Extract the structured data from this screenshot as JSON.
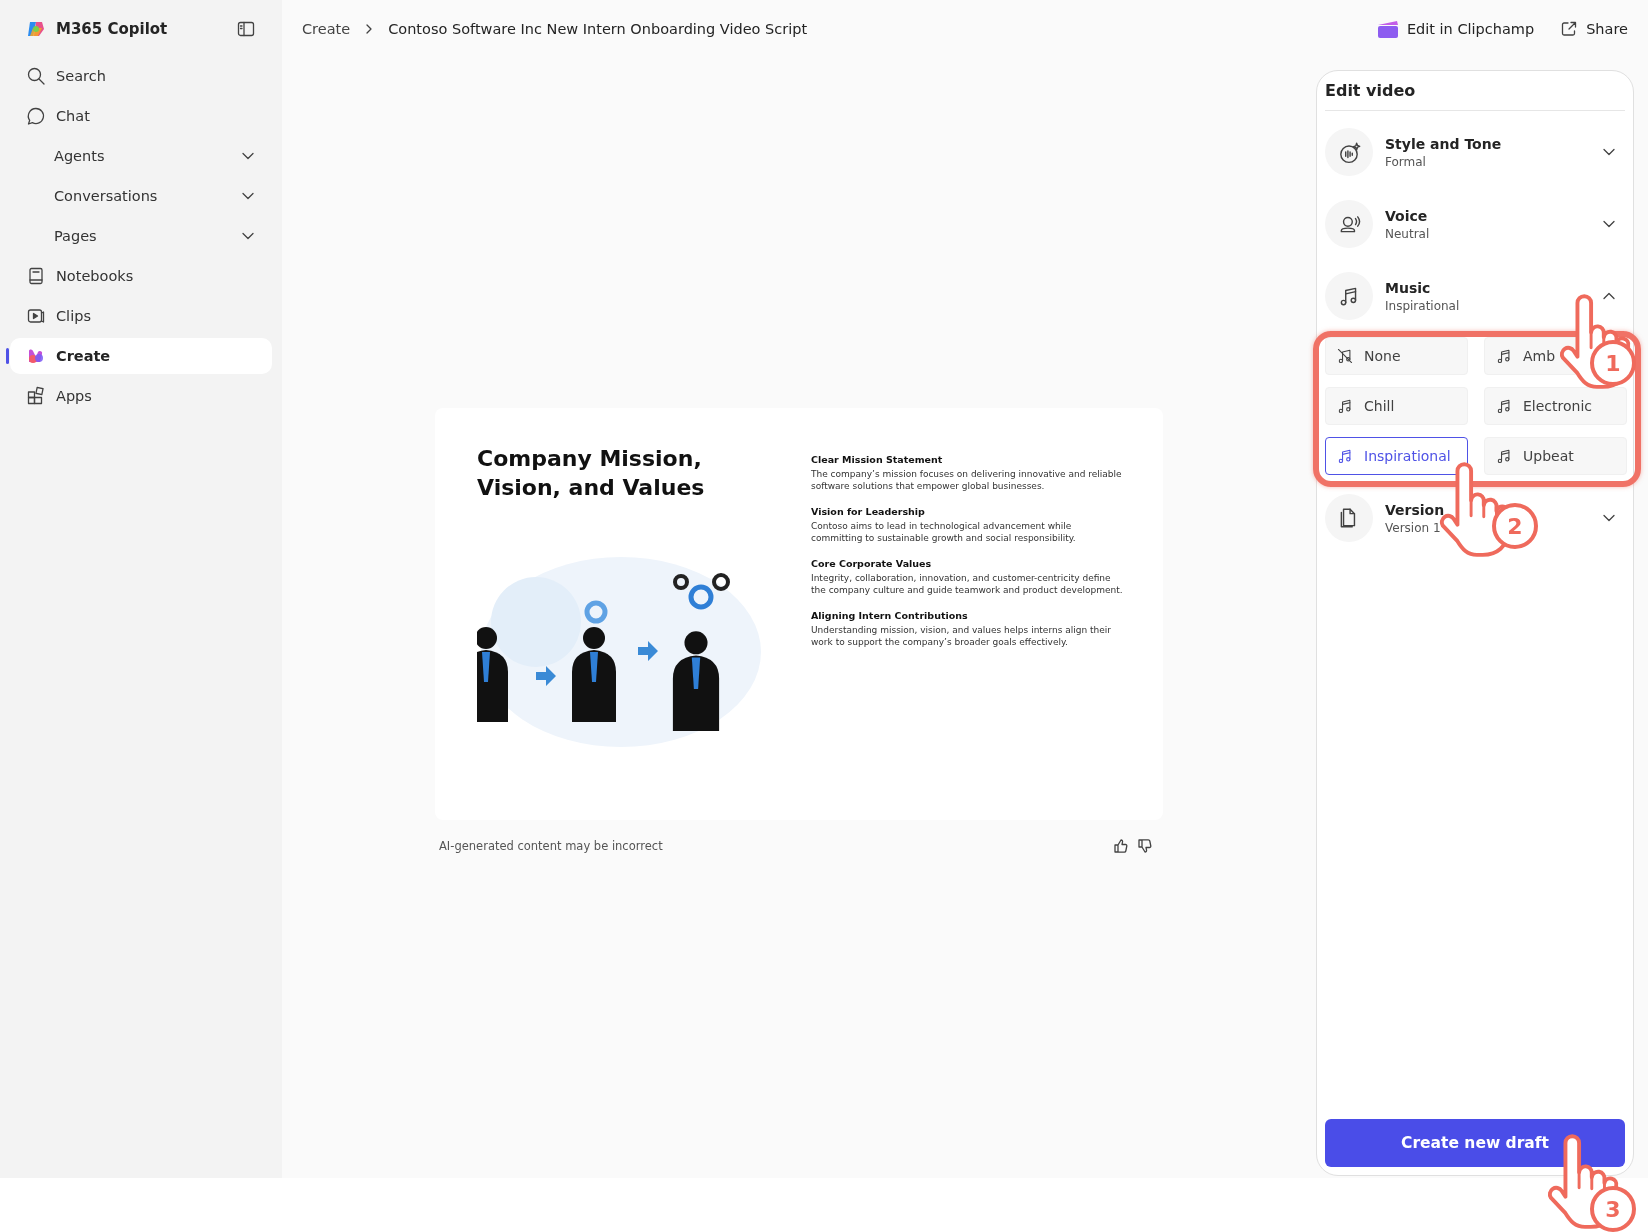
{
  "sidebar": {
    "app_name": "M365 Copilot",
    "items": [
      {
        "label": "Search",
        "kind": "link",
        "selected": false
      },
      {
        "label": "Chat",
        "kind": "link",
        "selected": false
      },
      {
        "label": "Agents",
        "kind": "group",
        "expanded": false,
        "selected": false
      },
      {
        "label": "Conversations",
        "kind": "group",
        "expanded": false,
        "selected": false
      },
      {
        "label": "Pages",
        "kind": "group",
        "expanded": false,
        "selected": false
      },
      {
        "label": "Notebooks",
        "kind": "link",
        "selected": false
      },
      {
        "label": "Clips",
        "kind": "link",
        "selected": false
      },
      {
        "label": "Create",
        "kind": "link",
        "selected": true
      },
      {
        "label": "Apps",
        "kind": "link",
        "selected": false
      }
    ]
  },
  "header": {
    "breadcrumb": [
      "Create",
      "Contoso Software Inc New Intern Onboarding Video Script"
    ],
    "actions": [
      "Edit in Clipchamp",
      "Share"
    ]
  },
  "slide": {
    "title": "Company Mission, Vision, and Values",
    "sections": [
      {
        "heading": "Clear Mission Statement",
        "body": "The company’s mission focuses on delivering innovative and reliable software solutions that empower global businesses."
      },
      {
        "heading": "Vision for Leadership",
        "body": "Contoso aims to lead in technological advancement while committing to sustainable growth and social responsibility."
      },
      {
        "heading": "Core Corporate Values",
        "body": "Integrity, collaboration, innovation, and customer-centricity define the company culture and guide teamwork and product development."
      },
      {
        "heading": "Aligning Intern Contributions",
        "body": "Understanding mission, vision, and values helps interns align their work to support the company’s broader goals effectively."
      }
    ]
  },
  "disclaimer": "AI-generated content may be incorrect",
  "panel": {
    "title": "Edit video",
    "settings": [
      {
        "title": "Style and Tone",
        "value": "Formal",
        "expanded": false
      },
      {
        "title": "Voice",
        "value": "Neutral",
        "expanded": false
      },
      {
        "title": "Music",
        "value": "Inspirational",
        "expanded": true,
        "options": [
          {
            "label": "None",
            "kind": "none",
            "selected": false
          },
          {
            "label": "Amb",
            "kind": "music",
            "selected": false
          },
          {
            "label": "Chill",
            "kind": "music",
            "selected": false
          },
          {
            "label": "Electronic",
            "kind": "music",
            "selected": false
          },
          {
            "label": "Inspirational",
            "kind": "music",
            "selected": true
          },
          {
            "label": "Upbeat",
            "kind": "music",
            "selected": false
          }
        ]
      },
      {
        "title": "Version",
        "value": "Version 1",
        "expanded": false
      }
    ],
    "button": "Create new draft"
  },
  "annotations": {
    "steps": [
      "1",
      "2",
      "3"
    ]
  }
}
